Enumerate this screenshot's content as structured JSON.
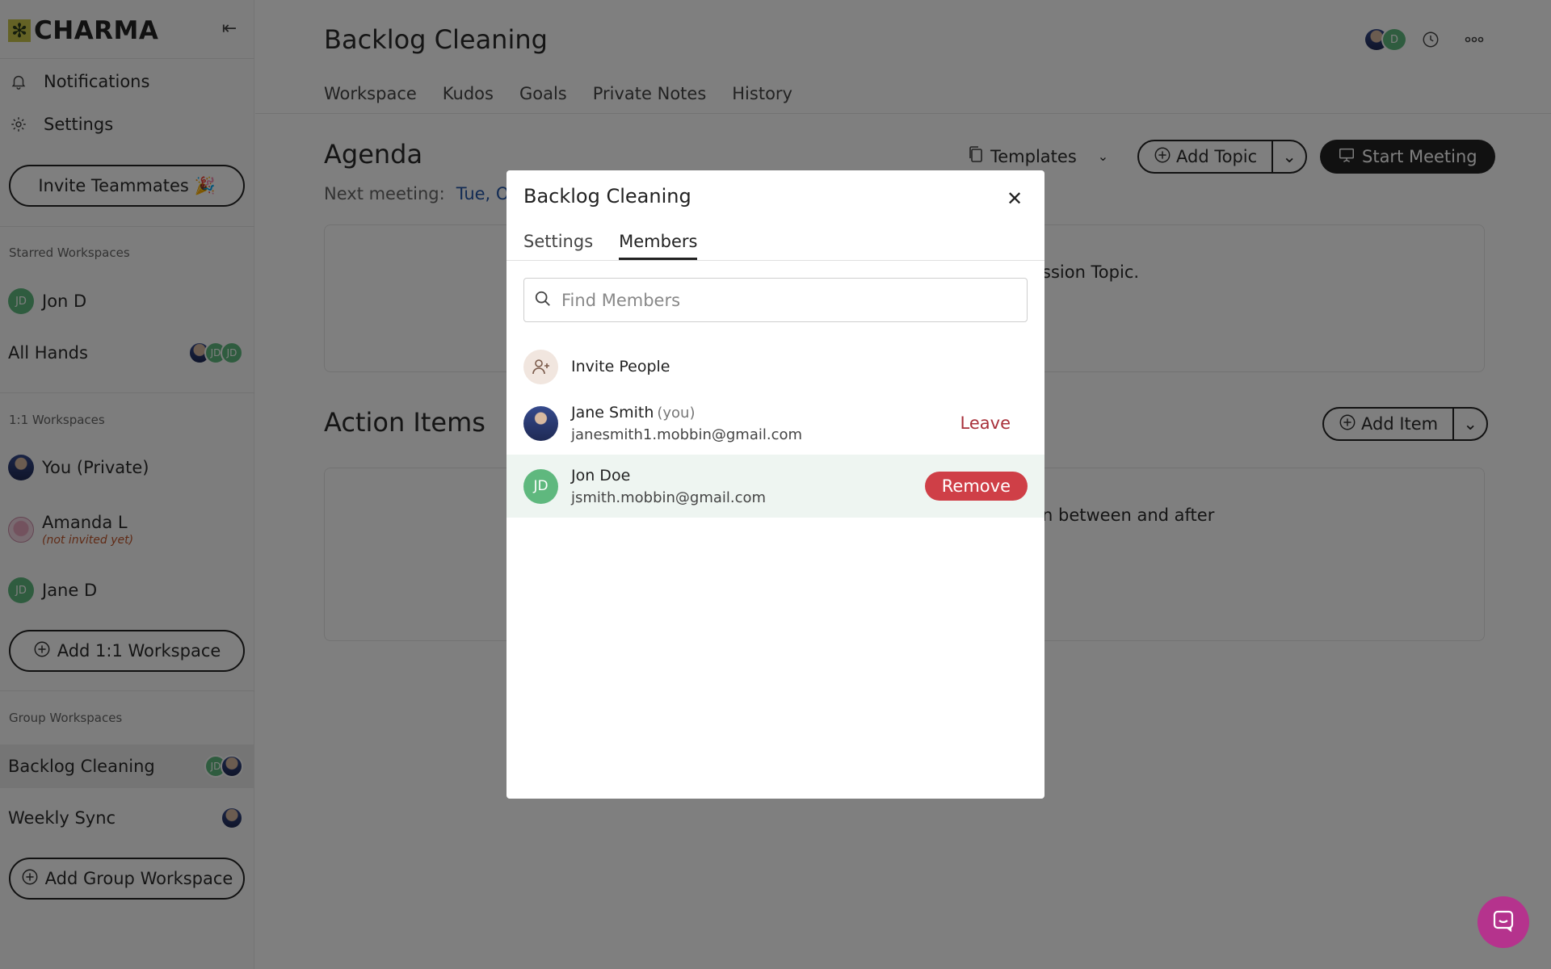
{
  "app": {
    "logo_text": "CHARMA",
    "logo_mark": "✻"
  },
  "sidebar": {
    "nav": [
      {
        "label": "Notifications",
        "icon": "bell-icon"
      },
      {
        "label": "Settings",
        "icon": "gear-icon"
      }
    ],
    "invite_button": "Invite Teammates 🎉",
    "starred_label": "Starred Workspaces",
    "starred": [
      {
        "name": "Jon D",
        "avatar": "JD"
      },
      {
        "name": "All Hands",
        "avatars": [
          "",
          "JD",
          "JD"
        ]
      }
    ],
    "one_on_one_label": "1:1 Workspaces",
    "one_on_one": [
      {
        "name": "You (Private)"
      },
      {
        "name": "Amanda L",
        "note": "(not invited yet)"
      },
      {
        "name": "Jane D",
        "avatar": "JD"
      }
    ],
    "add_one_on_one": "Add 1:1 Workspace",
    "group_label": "Group Workspaces",
    "groups": [
      {
        "name": "Backlog Cleaning",
        "avatars": [
          "JD",
          ""
        ],
        "active": true
      },
      {
        "name": "Weekly Sync",
        "avatars": [
          ""
        ]
      }
    ],
    "add_group": "Add Group Workspace"
  },
  "main": {
    "title": "Backlog Cleaning",
    "header_avatar": "D",
    "tabs": [
      "Workspace",
      "Kudos",
      "Goals",
      "Private Notes",
      "History"
    ],
    "agenda": {
      "title": "Agenda",
      "next_meeting_label": "Next meeting:",
      "next_meeting_date": "Tue, Oct",
      "templates_label": "Templates",
      "add_topic": "Add Topic",
      "start_meeting": "Start Meeting",
      "card_text": "ssion Topic."
    },
    "action_items": {
      "title": "Action Items",
      "add_item": "Add Item",
      "card_text": "n between and after"
    }
  },
  "modal": {
    "title": "Backlog Cleaning",
    "tabs": [
      "Settings",
      "Members"
    ],
    "active_tab": "Members",
    "search_placeholder": "Find Members",
    "invite_label": "Invite People",
    "members": [
      {
        "name": "Jane Smith",
        "you": "(you)",
        "email": "janesmith1.mobbin@gmail.com",
        "action": "Leave"
      },
      {
        "name": "Jon Doe",
        "avatar": "JD",
        "email": "jsmith.mobbin@gmail.com",
        "action": "Remove"
      }
    ]
  },
  "colors": {
    "accent_green": "#5fb87e",
    "remove_red": "#cf3f47",
    "leave_red": "#a8303a",
    "link_blue": "#2456a8",
    "chat_fab": "#b5338d"
  }
}
